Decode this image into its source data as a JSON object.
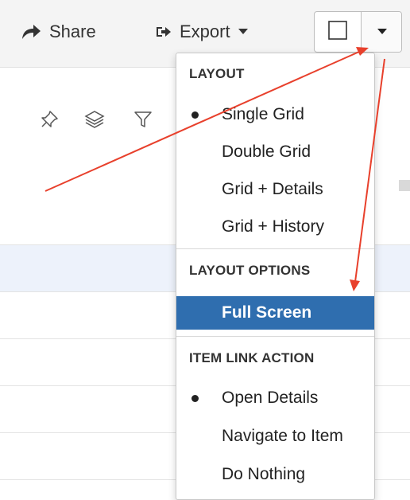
{
  "toolbar": {
    "share_label": "Share",
    "export_label": "Export"
  },
  "menu": {
    "layout_header": "LAYOUT",
    "layout_items": [
      {
        "label": "Single Grid",
        "selected": true
      },
      {
        "label": "Double Grid",
        "selected": false
      },
      {
        "label": "Grid + Details",
        "selected": false
      },
      {
        "label": "Grid + History",
        "selected": false
      }
    ],
    "options_header": "LAYOUT OPTIONS",
    "options_items": [
      {
        "label": "Full Screen",
        "highlighted": true
      }
    ],
    "link_header": "ITEM LINK ACTION",
    "link_items": [
      {
        "label": "Open Details",
        "selected": true
      },
      {
        "label": "Navigate to Item",
        "selected": false
      },
      {
        "label": "Do Nothing",
        "selected": false
      }
    ]
  },
  "colors": {
    "highlight": "#2f6eaf",
    "annotation_arrow": "#e8402c",
    "selected_row": "#edf2fb"
  }
}
